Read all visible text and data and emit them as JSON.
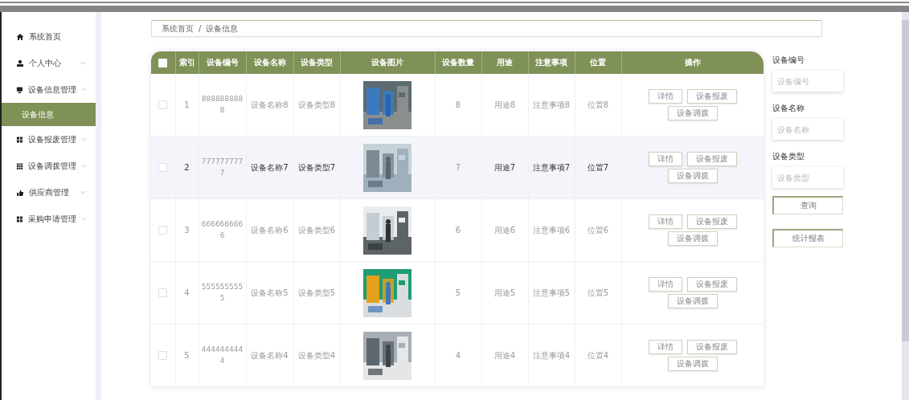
{
  "sidebar": {
    "items": [
      {
        "label": "系统首页"
      },
      {
        "label": "个人中心",
        "expanded": false
      },
      {
        "label": "设备信息管理",
        "expanded": true,
        "children": [
          {
            "label": "设备信息",
            "selected": true
          }
        ]
      },
      {
        "label": "设备报废管理",
        "expanded": false
      },
      {
        "label": "设备调拨管理",
        "expanded": false
      },
      {
        "label": "供应商管理",
        "expanded": false
      },
      {
        "label": "采购申请管理",
        "expanded": false
      }
    ]
  },
  "breadcrumb": {
    "items": [
      "系统首页",
      "设备信息"
    ],
    "separator": "/"
  },
  "table": {
    "header_checked": false,
    "columns": [
      "索引",
      "设备编号",
      "设备名称",
      "设备类型",
      "设备图片",
      "设备数量",
      "用途",
      "注意事项",
      "位置",
      "操作"
    ],
    "rows": [
      {
        "checked": false,
        "highlighted": false,
        "index": "1",
        "code": "8888888888",
        "name": "设备名称8",
        "type": "设备类型8",
        "quantity": "8",
        "use": "用途8",
        "notes": "注意事项8",
        "location": "位置8",
        "actions": [
          "详情",
          "设备报废",
          "设备调拨"
        ]
      },
      {
        "checked": false,
        "highlighted": true,
        "index": "2",
        "code": "7777777777",
        "name": "设备名称7",
        "type": "设备类型7",
        "quantity": "7",
        "use": "用途7",
        "notes": "注意事项7",
        "location": "位置7",
        "actions": [
          "详情",
          "设备报废",
          "设备调拨"
        ]
      },
      {
        "checked": false,
        "highlighted": false,
        "index": "3",
        "code": "6666666666",
        "name": "设备名称6",
        "type": "设备类型6",
        "quantity": "6",
        "use": "用途6",
        "notes": "注意事项6",
        "location": "位置6",
        "actions": [
          "详情",
          "设备报废",
          "设备调拨"
        ]
      },
      {
        "checked": false,
        "highlighted": false,
        "index": "4",
        "code": "5555555555",
        "name": "设备名称5",
        "type": "设备类型5",
        "quantity": "5",
        "use": "用途5",
        "notes": "注意事项5",
        "location": "位置5",
        "actions": [
          "详情",
          "设备报废",
          "设备调拨"
        ]
      },
      {
        "checked": false,
        "highlighted": false,
        "index": "5",
        "code": "4444444444",
        "name": "设备名称4",
        "type": "设备类型4",
        "quantity": "4",
        "use": "用途4",
        "notes": "注意事项4",
        "location": "位置4",
        "actions": [
          "详情",
          "设备报废",
          "设备调拨"
        ]
      }
    ]
  },
  "search_panel": {
    "filters": [
      {
        "label": "设备编号",
        "placeholder": "设备编号"
      },
      {
        "label": "设备名称",
        "placeholder": "设备名称"
      },
      {
        "label": "设备类型",
        "placeholder": "设备类型"
      }
    ],
    "buttons": [
      "查询",
      "统计报表"
    ]
  }
}
